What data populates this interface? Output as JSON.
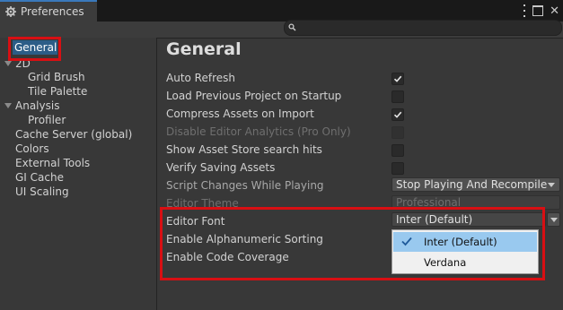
{
  "window": {
    "title": "Preferences"
  },
  "search": {
    "placeholder": ""
  },
  "sidebar": {
    "items": [
      {
        "label": "General"
      },
      {
        "label": "2D"
      },
      {
        "label": "Grid Brush"
      },
      {
        "label": "Tile Palette"
      },
      {
        "label": "Analysis"
      },
      {
        "label": "Profiler"
      },
      {
        "label": "Cache Server (global)"
      },
      {
        "label": "Colors"
      },
      {
        "label": "External Tools"
      },
      {
        "label": "GI Cache"
      },
      {
        "label": "UI Scaling"
      }
    ]
  },
  "main": {
    "title": "General",
    "settings": [
      {
        "label": "Auto Refresh",
        "checked": true
      },
      {
        "label": "Load Previous Project on Startup",
        "checked": false
      },
      {
        "label": "Compress Assets on Import",
        "checked": true
      },
      {
        "label": "Disable Editor Analytics (Pro Only)",
        "checked": false,
        "disabled": true
      },
      {
        "label": "Show Asset Store search hits",
        "checked": false
      },
      {
        "label": "Verify Saving Assets",
        "checked": false
      },
      {
        "label": "Script Changes While Playing",
        "value": "Stop Playing And Recompile"
      },
      {
        "label": "Editor Theme",
        "value": "Professional",
        "disabled": true
      },
      {
        "label": "Editor Font",
        "value": "Inter (Default)"
      },
      {
        "label": "Enable Alphanumeric Sorting"
      },
      {
        "label": "Enable Code Coverage"
      }
    ],
    "font_menu": {
      "options": [
        {
          "label": "Inter (Default)",
          "selected": true
        },
        {
          "label": "Verdana",
          "selected": false
        }
      ]
    }
  },
  "colors": {
    "highlight_border": "#d80f13",
    "selection": "#2c5d87",
    "menu_selection": "#99c9ef"
  }
}
